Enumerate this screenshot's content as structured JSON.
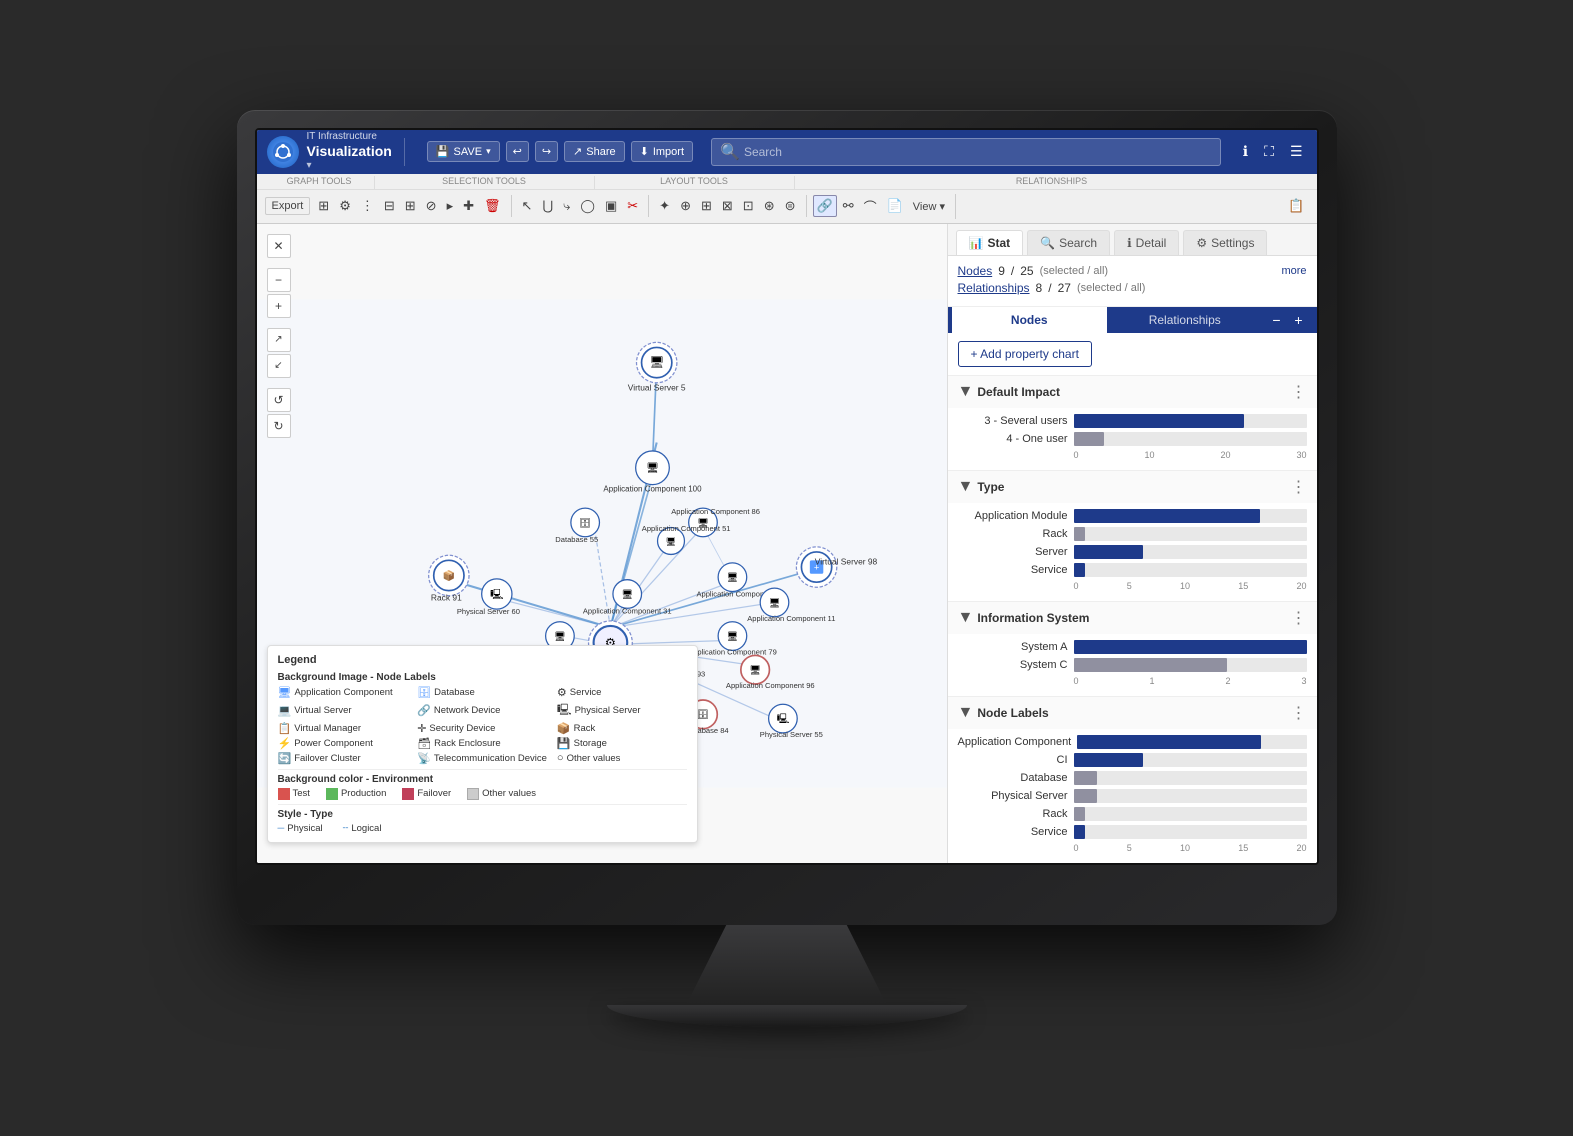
{
  "app": {
    "subtitle": "IT Infrastructure",
    "title": "Visualization",
    "logo_symbol": "🔷"
  },
  "toolbar": {
    "save_label": "SAVE",
    "share_label": "Share",
    "import_label": "Import",
    "export_label": "Export",
    "search_placeholder": "Search"
  },
  "toolbar_sections": {
    "graph_tools": "GRAPH TOOLS",
    "selection_tools": "SELECTION TOOLS",
    "layout_tools": "LAYOUT TOOLS",
    "relationships": "RELATIONSHIPS"
  },
  "panel": {
    "tabs": [
      "Stat",
      "Search",
      "Detail",
      "Settings"
    ],
    "active_tab": "Stat",
    "nodes_label": "Nodes",
    "nodes_selected": "9",
    "nodes_total": "25",
    "relationships_label": "Relationships",
    "rel_selected": "8",
    "rel_total": "27",
    "sel_all_label": "(selected / all)",
    "more_label": "more",
    "nr_tabs": [
      "Nodes",
      "Relationships"
    ],
    "active_nr_tab": "Nodes",
    "add_property_label": "+ Add property chart"
  },
  "default_impact": {
    "title": "Default Impact",
    "bars": [
      {
        "label": "3 - Several users",
        "value": 22,
        "max": 30,
        "color": "#1e3a8a"
      },
      {
        "label": "4 - One user",
        "value": 4,
        "max": 30,
        "color": "#9090a0"
      }
    ],
    "axis": [
      "0",
      "10",
      "20",
      "30"
    ]
  },
  "type_chart": {
    "title": "Type",
    "bars": [
      {
        "label": "Application Module",
        "value": 16,
        "max": 20,
        "color": "#1e3a8a"
      },
      {
        "label": "Rack",
        "value": 1,
        "max": 20,
        "color": "#9090a0"
      },
      {
        "label": "Server",
        "value": 6,
        "max": 20,
        "color": "#1e3a8a"
      },
      {
        "label": "Service",
        "value": 1,
        "max": 20,
        "color": "#1e3a8a"
      }
    ],
    "axis": [
      "0",
      "5",
      "10",
      "15",
      "20"
    ]
  },
  "info_system": {
    "title": "Information System",
    "bars": [
      {
        "label": "System A",
        "value": 3,
        "max": 3,
        "color": "#1e3a8a"
      },
      {
        "label": "System C",
        "value": 2,
        "max": 3,
        "color": "#9090a0"
      }
    ],
    "axis": [
      "0",
      "1",
      "2",
      "3"
    ]
  },
  "node_labels": {
    "title": "Node Labels",
    "bars": [
      {
        "label": "Application Component",
        "value": 16,
        "max": 20,
        "color": "#1e3a8a"
      },
      {
        "label": "CI",
        "value": 6,
        "max": 20,
        "color": "#1e3a8a"
      },
      {
        "label": "Database",
        "value": 2,
        "max": 20,
        "color": "#9090a0"
      },
      {
        "label": "Physical Server",
        "value": 2,
        "max": 20,
        "color": "#9090a0"
      },
      {
        "label": "Rack",
        "value": 1,
        "max": 20,
        "color": "#9090a0"
      },
      {
        "label": "Service",
        "value": 1,
        "max": 20,
        "color": "#1e3a8a"
      }
    ],
    "axis": [
      "0",
      "5",
      "10",
      "15",
      "20"
    ]
  },
  "legend": {
    "title": "Legend",
    "bg_image_label": "Background Image - Node Labels",
    "bg_color_label": "Background color - Environment",
    "style_label": "Style - Type",
    "node_types": [
      {
        "name": "Application Component",
        "icon": "🖥"
      },
      {
        "name": "Database",
        "icon": "🗄"
      },
      {
        "name": "Service",
        "icon": "⚙"
      },
      {
        "name": "Virtual Server",
        "icon": "💻"
      },
      {
        "name": "Network Device",
        "icon": "🔗"
      },
      {
        "name": "Physical Server",
        "icon": "🖳"
      },
      {
        "name": "Virtual Manager",
        "icon": "📋"
      },
      {
        "name": "Security Device",
        "icon": "🛡"
      },
      {
        "name": "Rack",
        "icon": "📦"
      },
      {
        "name": "Power Component",
        "icon": "⚡"
      },
      {
        "name": "Rack Enclosure",
        "icon": "🗃"
      },
      {
        "name": "Storage",
        "icon": "💾"
      },
      {
        "name": "Failover Cluster",
        "icon": "🔄"
      },
      {
        "name": "Telecommunication Device",
        "icon": "📡"
      },
      {
        "name": "Other values",
        "icon": "○"
      }
    ],
    "env_colors": [
      {
        "name": "Test",
        "color": "#d9534f"
      },
      {
        "name": "Production",
        "color": "#5cb85c"
      },
      {
        "name": "Failover",
        "color": "#c0405a"
      },
      {
        "name": "Other values",
        "color": "#ccc"
      }
    ],
    "style_types": [
      {
        "name": "Physical"
      },
      {
        "name": "Logical"
      }
    ]
  },
  "canvas_controls": {
    "close": "✕",
    "zoom_out": "−",
    "zoom_in": "+",
    "diagonal_expand": "↗",
    "diagonal_contract": "↙",
    "rotate_ccw": "↺",
    "rotate_cw": "↻"
  }
}
